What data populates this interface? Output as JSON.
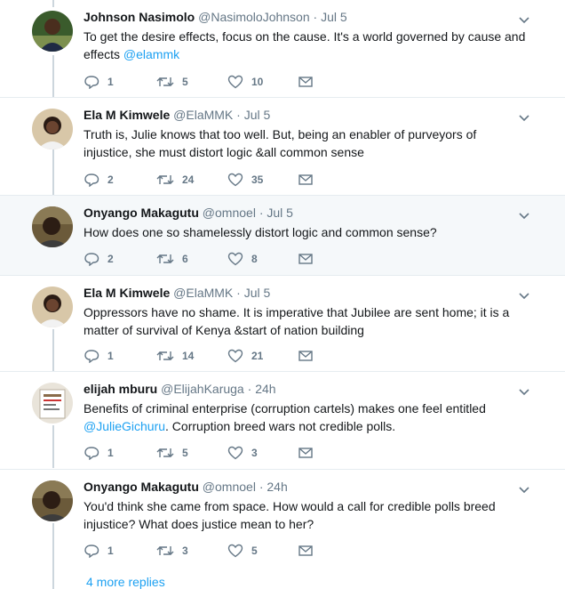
{
  "tweets": [
    {
      "name": "Johnson Nasimolo",
      "handle": "@NasimoloJohnson",
      "time": "Jul 5",
      "text": "To get the desire effects, focus on the cause. It's a world governed by cause and effects ",
      "mention": "@elammk",
      "mention2": "",
      "tail": "",
      "replies": "1",
      "retweets": "5",
      "likes": "10",
      "avatar": "avatar-johnson"
    },
    {
      "name": "Ela M Kimwele",
      "handle": "@ElaMMK",
      "time": "Jul 5",
      "text": "Truth is, Julie knows that too well. But, being an enabler of purveyors of injustice, she must distort logic &all common sense",
      "mention": "",
      "replies": "2",
      "retweets": "24",
      "likes": "35",
      "avatar": "avatar-ela"
    },
    {
      "name": "Onyango Makagutu",
      "handle": "@omnoel",
      "time": "Jul 5",
      "text": "How does one so shamelessly distort logic and common sense?",
      "mention": "",
      "replies": "2",
      "retweets": "6",
      "likes": "8",
      "avatar": "avatar-onyango"
    },
    {
      "name": "Ela M Kimwele",
      "handle": "@ElaMMK",
      "time": "Jul 5",
      "text": "Oppressors have no shame. It is imperative that Jubilee are sent home; it is a matter of survival of Kenya &start of nation building",
      "mention": "",
      "replies": "1",
      "retweets": "14",
      "likes": "21",
      "avatar": "avatar-ela"
    },
    {
      "name": "elijah mburu",
      "handle": "@ElijahKaruga",
      "time": "24h",
      "text": "Benefits of criminal enterprise (corruption cartels) makes one feel entitled ",
      "mention": "@JulieGichuru",
      "tail": ". Corruption breed wars not credible polls.",
      "replies": "1",
      "retweets": "5",
      "likes": "3",
      "avatar": "avatar-elijah"
    },
    {
      "name": "Onyango Makagutu",
      "handle": "@omnoel",
      "time": "24h",
      "text": "You'd think she came from space. How would a call for credible polls breed injustice?  What does justice mean to her?",
      "mention": "",
      "replies": "1",
      "retweets": "3",
      "likes": "5",
      "avatar": "avatar-onyango"
    }
  ],
  "more_replies": "4 more replies",
  "colors": {
    "accent": "#1da1f2",
    "muted": "#657786",
    "line": "#ccd6dd",
    "highlight": "#f5f8fa"
  }
}
